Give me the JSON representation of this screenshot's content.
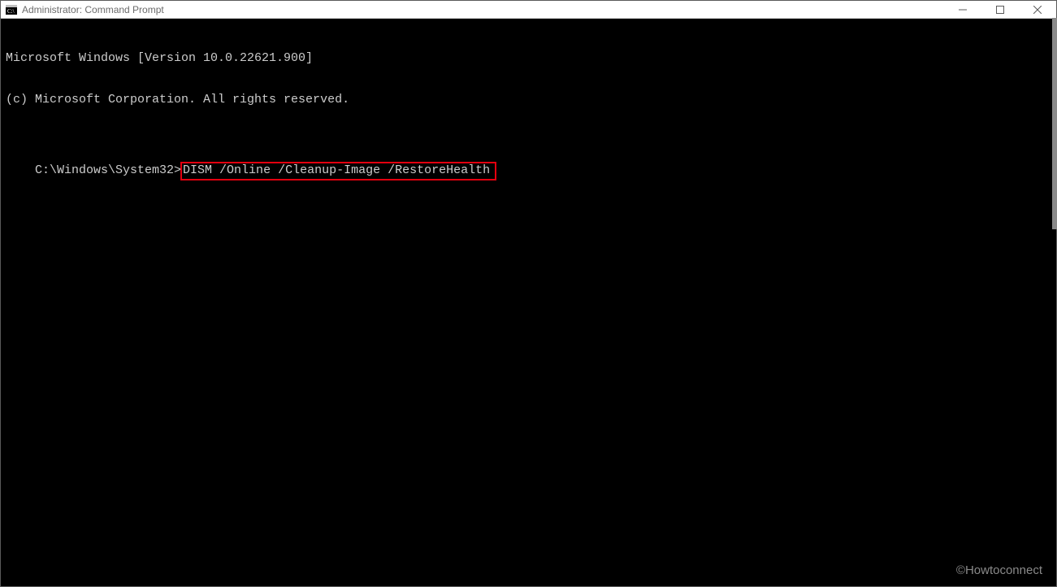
{
  "titlebar": {
    "title": "Administrator: Command Prompt",
    "icon_label": "cmd-icon"
  },
  "terminal": {
    "line1": "Microsoft Windows [Version 10.0.22621.900]",
    "line2": "(c) Microsoft Corporation. All rights reserved.",
    "prompt": "C:\\Windows\\System32>",
    "command": "DISM /Online /Cleanup-Image /RestoreHealth"
  },
  "watermark": "©Howtoconnect"
}
